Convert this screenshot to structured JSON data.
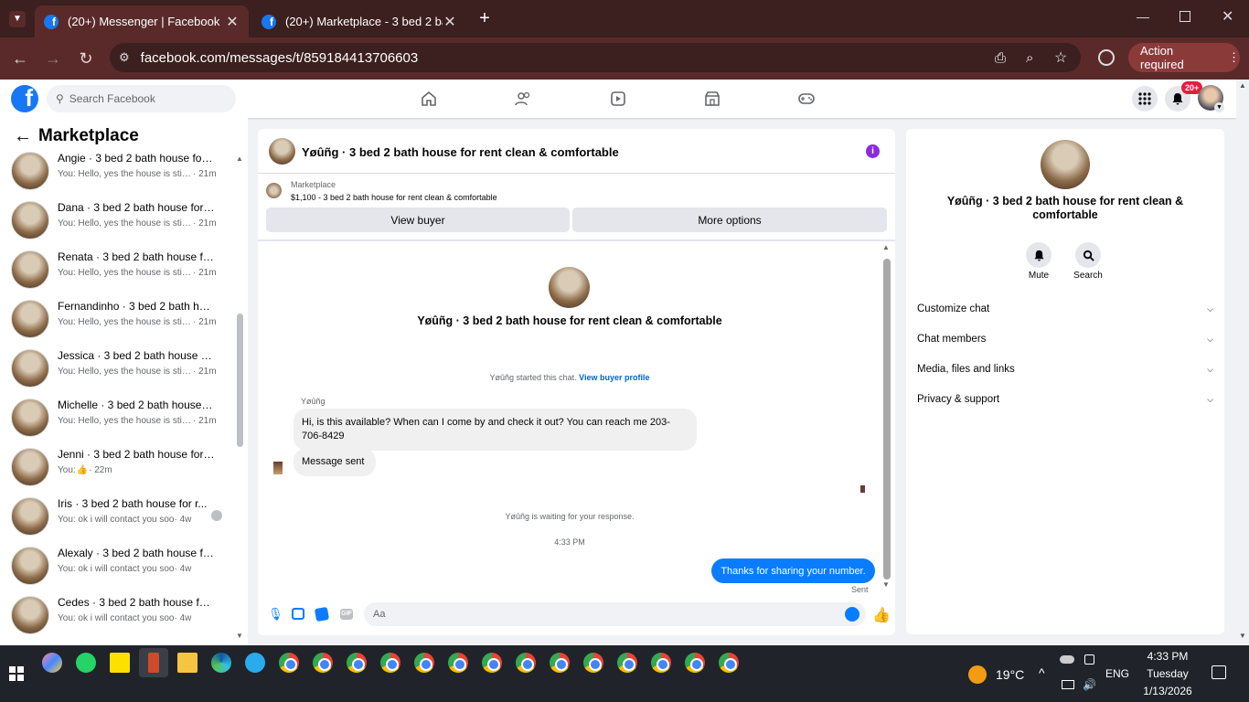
{
  "browser": {
    "tabs": [
      {
        "title": "(20+) Messenger | Facebook",
        "active": true
      },
      {
        "title": "(20+) Marketplace - 3 bed 2 ba",
        "active": false
      }
    ],
    "url": "facebook.com/messages/t/859184413706603",
    "action_required": "Action required"
  },
  "fb": {
    "search_placeholder": "Search Facebook",
    "notif_badge": "20+"
  },
  "left": {
    "title": "Marketplace",
    "conversations": [
      {
        "name": "Angie · 3 bed 2 bath house for ...",
        "preview": "You: Hello, yes the house is still a...",
        "time": "· 21m"
      },
      {
        "name": "Dana · 3 bed 2 bath house for r...",
        "preview": "You: Hello, yes the house is still a...",
        "time": "· 21m"
      },
      {
        "name": "Renata · 3 bed 2 bath house for...",
        "preview": "You: Hello, yes the house is still a...",
        "time": "· 21m"
      },
      {
        "name": "Fernandinho · 3 bed 2 bath hou...",
        "preview": "You: Hello, yes the house is still a...",
        "time": "· 21m"
      },
      {
        "name": "Jessica · 3 bed 2 bath house for...",
        "preview": "You: Hello, yes the house is still a...",
        "time": "· 21m"
      },
      {
        "name": "Michelle · 3 bed 2 bath house f...",
        "preview": "You: Hello, yes the house is still a...",
        "time": "· 21m"
      },
      {
        "name": "Jenni · 3 bed 2 bath house for r...",
        "preview": "You: ",
        "time": "· 22m"
      },
      {
        "name": "Iris · 3 bed 2 bath house for r...",
        "preview": "You: ok i will contact you soo",
        "time": "· 4w"
      },
      {
        "name": "Alexaly · 3 bed 2 bath house for...",
        "preview": "You: ok i will contact you soo",
        "time": "· 4w"
      },
      {
        "name": "Cedes · 3 bed 2 bath house for ...",
        "preview": "You: ok i will contact you soo",
        "time": "· 4w"
      }
    ]
  },
  "chat": {
    "header_title": "Yøûñg · 3 bed 2 bath house for rent clean & comfortable",
    "listing_source": "Marketplace",
    "listing_line": "$1,100 - 3 bed 2 bath house for rent clean & comfortable",
    "view_buyer": "View buyer",
    "more_options": "More options",
    "profile_name": "Yøûñg · 3 bed 2 bath house for rent clean & comfortable",
    "started_text": "Yøûñg started this chat.",
    "view_buyer_profile": "View buyer profile",
    "sender_name": "Yøûñg",
    "message1": "Hi, is this available? When can I come by and check it out? You can reach me 203-706-8429",
    "message2": "Message sent",
    "waiting_text": "Yøûñg is waiting for your response.",
    "timestamp": "4:33 PM",
    "my_message": "Thanks for sharing your number.",
    "sent_status": "Sent",
    "composer_placeholder": "Aa"
  },
  "right": {
    "name": "Yøûñg · 3 bed 2 bath house for rent clean & comfortable",
    "mute": "Mute",
    "search": "Search",
    "sections": [
      "Customize chat",
      "Chat members",
      "Media, files and links",
      "Privacy & support"
    ]
  },
  "taskbar": {
    "temperature": "19°C",
    "lang": "ENG",
    "time": "4:33 PM",
    "day": "Tuesday",
    "date": "1/13/2026"
  },
  "colors": {
    "brand": "#1877f2",
    "tab_bg": "#3c1f1f",
    "toolbar_bg": "#5a2a2a",
    "info_icon": "#8a2be2"
  }
}
